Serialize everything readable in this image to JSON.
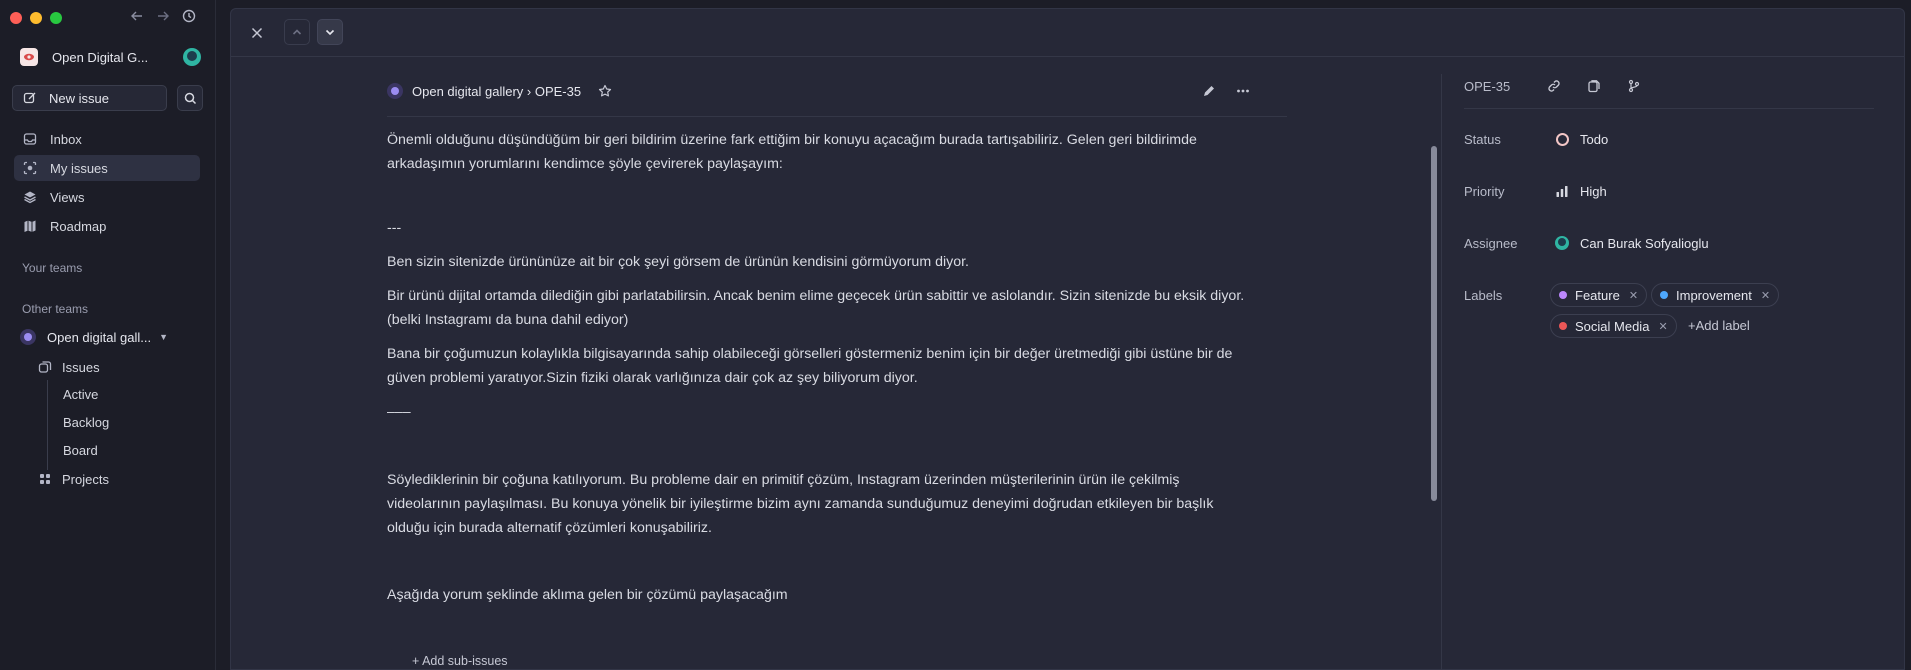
{
  "sidebar": {
    "workspace_name": "Open Digital G...",
    "new_issue_label": "New issue",
    "items": [
      {
        "label": "Inbox",
        "icon": "inbox-icon"
      },
      {
        "label": "My issues",
        "icon": "my-issues-icon"
      },
      {
        "label": "Views",
        "icon": "layers-icon"
      },
      {
        "label": "Roadmap",
        "icon": "map-icon"
      }
    ],
    "your_teams_label": "Your teams",
    "other_teams_label": "Other teams",
    "team_name": "Open digital gall...",
    "team_items": {
      "issues": "Issues",
      "active": "Active",
      "backlog": "Backlog",
      "board": "Board",
      "projects": "Projects"
    }
  },
  "issue": {
    "breadcrumb": "Open digital gallery › OPE-35",
    "paragraphs": [
      "Önemli olduğunu düşündüğüm bir geri bildirim üzerine fark ettiğim bir konuyu açacağım burada tartışabiliriz. Gelen geri bildirimde arkadaşımın yorumlarını kendimce şöyle çevirerek paylaşayım:",
      "---",
      "Ben sizin sitenizde ürününüze ait bir çok şeyi görsem de ürünün kendisini görmüyorum diyor.",
      "Bir ürünü dijital ortamda dilediğin gibi parlatabilirsin. Ancak benim elime geçecek ürün sabittir ve aslolandır. Sizin sitenizde bu eksik diyor. (belki Instagramı da buna dahil ediyor)",
      "Bana bir çoğumuzun kolaylıkla bilgisayarında sahip olabileceği görselleri göstermeniz benim için bir değer üretmediği gibi üstüne bir de güven problemi yaratıyor.Sizin fiziki olarak varlığınıza dair çok az şey biliyorum diyor.",
      "–––",
      "Söylediklerinin bir çoğuna katılıyorum. Bu probleme dair en primitif çözüm, Instagram üzerinden müşterilerinin ürün ile çekilmiş videolarının paylaşılması. Bu konuya yönelik bir iyileştirme bizim aynı zamanda sunduğumuz deneyimi doğrudan etkileyen bir başlık olduğu için burada alternatif çözümleri konuşabiliriz.",
      "Aşağıda yorum şeklinde aklıma gelen bir çözümü paylaşacağım"
    ],
    "add_sub_issues": "+ Add sub-issues"
  },
  "properties": {
    "id": "OPE-35",
    "status_label": "Status",
    "status_value": "Todo",
    "priority_label": "Priority",
    "priority_value": "High",
    "assignee_label": "Assignee",
    "assignee_value": "Can Burak Sofyalioglu",
    "labels_label": "Labels",
    "labels": [
      {
        "name": "Feature",
        "color": "#bb87fc"
      },
      {
        "name": "Improvement",
        "color": "#4ea7fc"
      },
      {
        "name": "Social Media",
        "color": "#eb5757"
      }
    ],
    "add_label": "+Add label"
  }
}
